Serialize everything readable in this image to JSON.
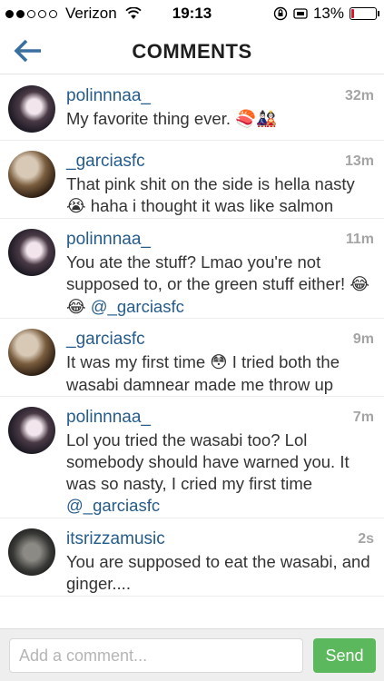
{
  "status_bar": {
    "carrier": "Verizon",
    "time": "19:13",
    "battery_percent": "13%",
    "battery_level": 0.13,
    "signal_bars_filled": 2,
    "signal_bars_total": 5
  },
  "header": {
    "title": "COMMENTS",
    "back_icon": "back-arrow-icon"
  },
  "comments": [
    {
      "username": "polinnnaa_",
      "time": "32m",
      "text": "My favorite thing ever. ",
      "emoji": "🍣🎎",
      "mention": ""
    },
    {
      "username": "_garciasfc",
      "time": "13m",
      "text_before": "That pink shit on the side is hella nasty ",
      "emoji": "😭",
      "text_after": " haha i thought it was like salmon"
    },
    {
      "username": "polinnnaa_",
      "time": "11m",
      "text": "You ate the stuff? Lmao you're not supposed to, or the green stuff either! ",
      "emoji": "😂😂",
      "mention": " @_garciasfc"
    },
    {
      "username": "_garciasfc",
      "time": "9m",
      "text_before": "It was my first time ",
      "emoji": "😳",
      "text_after": " I tried both the wasabi damnear made me throw up"
    },
    {
      "username": "polinnnaa_",
      "time": "7m",
      "text": "Lol you tried the wasabi too? Lol somebody should have warned you. It was so nasty, I cried my first time ",
      "mention": "@_garciasfc"
    },
    {
      "username": "itsrizzamusic",
      "time": "2s",
      "text": "You are supposed to eat the wasabi, and ginger...."
    }
  ],
  "comment_bar": {
    "placeholder": "Add a comment...",
    "send_label": "Send"
  },
  "colors": {
    "username": "#255c8c",
    "accent_back": "#3a6f9e",
    "send_button": "#5cb85c",
    "battery_low": "#e0142c"
  }
}
